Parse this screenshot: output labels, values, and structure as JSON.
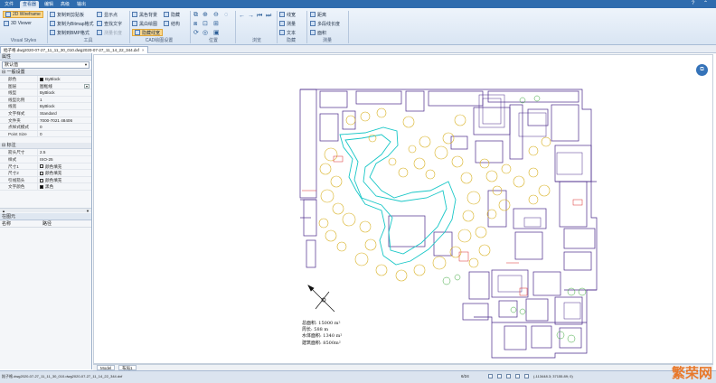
{
  "menu": {
    "tabs": [
      "文件",
      "查看器",
      "编辑",
      "高级",
      "输出"
    ],
    "active_index": 1
  },
  "ribbon": {
    "visual_styles": {
      "wireframe": "2D Wireframe",
      "viewer": "3D Viewer",
      "label": "Visual Styles"
    },
    "tools": {
      "items": [
        "复制到剪贴板",
        "复制为Bitmap格式",
        "复制到BMP格式"
      ],
      "items2": [
        "显示点",
        "查找文字",
        "测量长度"
      ],
      "label": "工具"
    },
    "cad_settings": {
      "items": [
        "黑色背景",
        "黑白绘图",
        "隐藏线宽"
      ],
      "items2": [
        "隐藏",
        "结构"
      ],
      "label": "CAD绘图设置"
    },
    "position": {
      "label": "位置"
    },
    "browse": {
      "label": "浏览"
    },
    "hide": {
      "items": [
        "线宽",
        "测量",
        "文本"
      ],
      "label": "隐藏"
    },
    "measure": {
      "items": [
        "距离",
        "多段线长度",
        "面积"
      ],
      "label": "测量"
    }
  },
  "document": {
    "tab_title": "拙子格.dwg2020-07-27_11_11_30_010.dwg2020-07-27_11_14_22_344.dxf"
  },
  "properties": {
    "header": "属性",
    "selector": "默认值",
    "sections": [
      {
        "title": "一般设置",
        "rows": [
          {
            "key": "颜色",
            "value": "ByBlock",
            "swatch": "black"
          },
          {
            "key": "图层",
            "value": "图框线",
            "dropdown": true
          },
          {
            "key": "线型",
            "value": "ByBlock"
          },
          {
            "key": "线型比例",
            "value": "1"
          },
          {
            "key": "线宽",
            "value": "ByBlock"
          },
          {
            "key": "文字样式",
            "value": "Standard"
          },
          {
            "key": "文件夹",
            "value": "7000-7021 48406"
          },
          {
            "key": "点样式模式",
            "value": "0"
          },
          {
            "key": "Point Size",
            "value": "0"
          }
        ]
      },
      {
        "title": "标注",
        "rows": [
          {
            "key": "箭头尺寸",
            "value": "2.5"
          },
          {
            "key": "样式",
            "value": "ISO-25"
          },
          {
            "key": "尺寸1",
            "value": "颜色填充",
            "swatch": "white"
          },
          {
            "key": "尺寸2",
            "value": "颜色填充",
            "swatch": "white"
          },
          {
            "key": "引线箭头",
            "value": "颜色填充",
            "swatch": "white"
          },
          {
            "key": "文字颜色",
            "value": "黑色",
            "swatch": "black"
          }
        ]
      }
    ]
  },
  "layers_panel": {
    "header": "在图元",
    "columns": [
      "名称",
      "路径"
    ]
  },
  "canvas": {
    "notes": [
      "总面积: 15000 m²",
      "周长:   588 m",
      "水体面积: 1340 m²",
      "建筑面积: 8500m²"
    ]
  },
  "bottom_tabs": [
    "Model",
    "布局1"
  ],
  "status": {
    "file": "拙子格.dwg2020-07-27_11_11_30_010.dwg2020-07-27_11_14_22_344.dxf",
    "page": "6/24",
    "coords": "(-113448.3; 37155.89; 0)"
  },
  "watermark": "繁荣网",
  "colors": {
    "ribbon_blue": "#2f6cae",
    "plan_walls": "#4a2a8a",
    "plan_trees": "#d8b020",
    "plan_water": "#19c7c7",
    "plan_red": "#d92a2a",
    "plan_green": "#3aa63a"
  }
}
